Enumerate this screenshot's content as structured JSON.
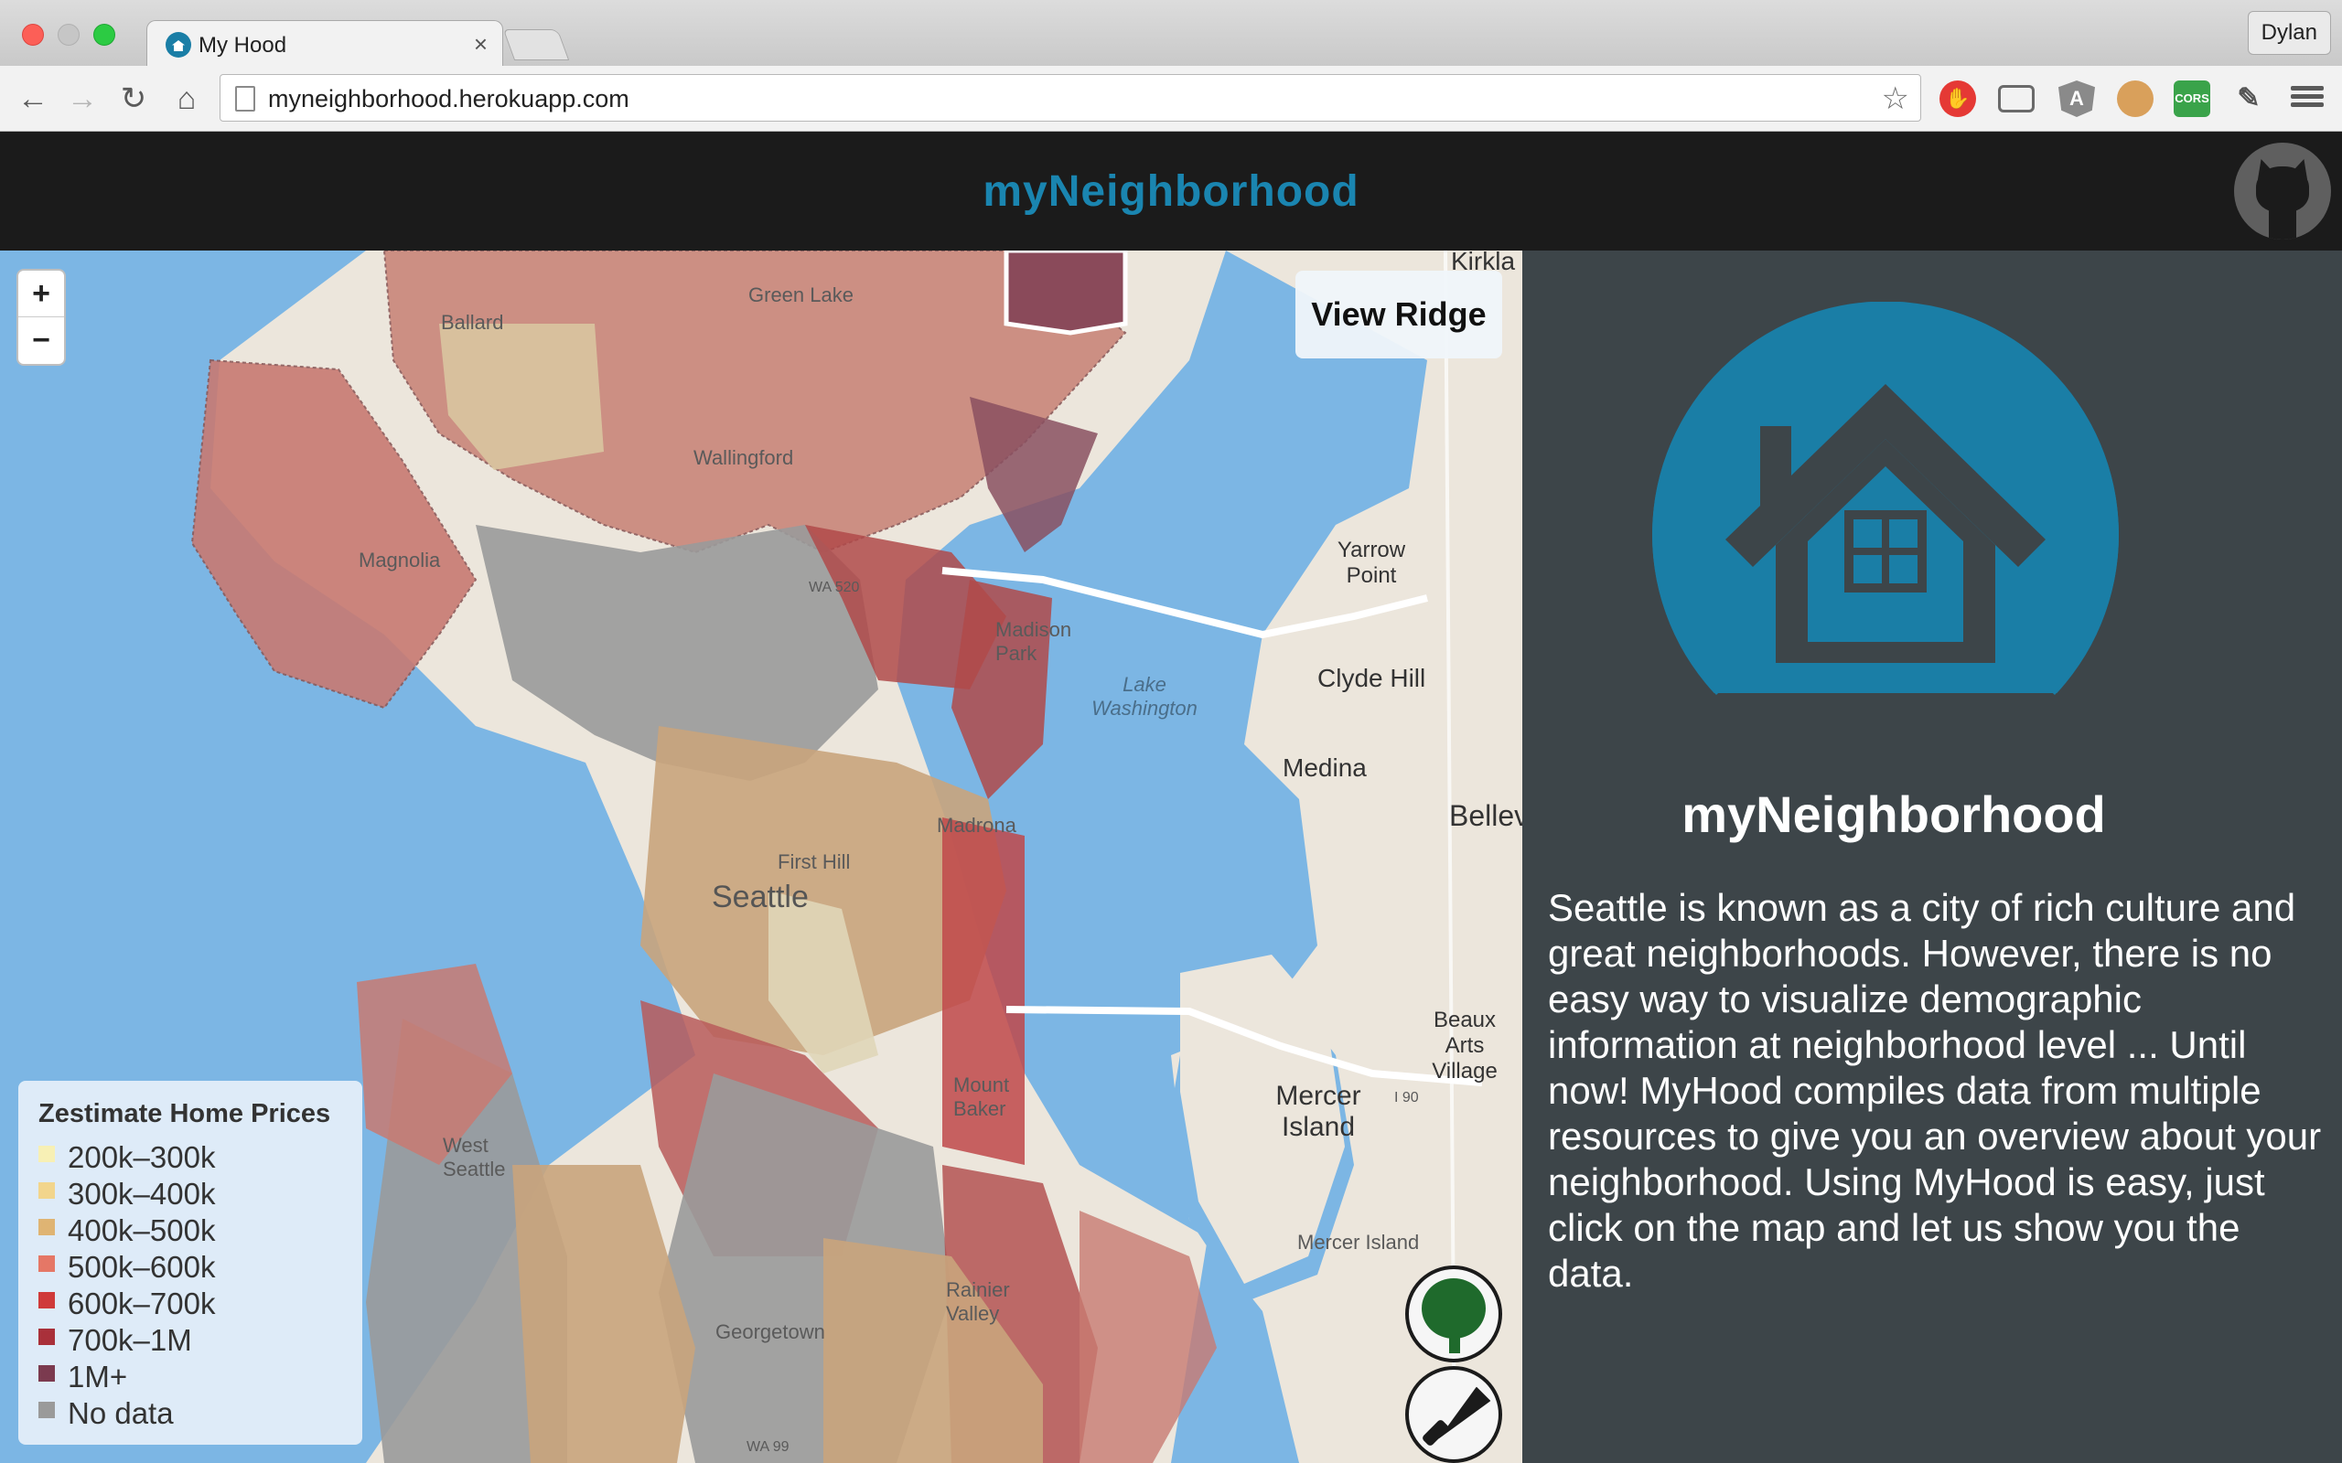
{
  "browser": {
    "tab_title": "My Hood",
    "tab_close": "×",
    "profile_name": "Dylan",
    "url": "myneighborhood.herokuapp.com",
    "back": "←",
    "forward": "→",
    "reload": "↻",
    "home": "⌂",
    "star": "☆",
    "extensions": {
      "cors_label": "CORS",
      "angular_label": "A"
    }
  },
  "site": {
    "brand": "myNeighborhood"
  },
  "map": {
    "zoom_in": "+",
    "zoom_out": "−",
    "hover_neighborhood": "View Ridge",
    "labels": {
      "green_lake": "Green Lake",
      "ballard": "Ballard",
      "wallingford": "Wallingford",
      "magnolia": "Magnolia",
      "madison_park": "Madison Park",
      "lake_washington": "Lake Washington",
      "yarrow_point": "Yarrow Point",
      "clyde_hill": "Clyde Hill",
      "medina": "Medina",
      "bellevue": "Bellev",
      "ballard_area": "Ballard",
      "first_hill": "First Hill",
      "seattle": "Seattle",
      "madrona": "Madrona",
      "mercer_island": "Mercer Island",
      "mercer_island_small": "Mercer Island",
      "beaux_arts": "Beaux Arts Village",
      "mount_baker": "Mount Baker",
      "west_seattle": "West Seattle",
      "rainier_valley": "Rainier Valley",
      "georgetown": "Georgetown",
      "kirkland": "Kirkla",
      "wa520": "WA 520",
      "i90": "I 90",
      "wa99": "WA 99"
    },
    "legend": {
      "title": "Zestimate Home Prices",
      "items": [
        {
          "label": "200k–300k",
          "color": "#f7f0b5"
        },
        {
          "label": "300k–400k",
          "color": "#f2d58c"
        },
        {
          "label": "400k–500k",
          "color": "#dfb473"
        },
        {
          "label": "500k–600k",
          "color": "#e57766"
        },
        {
          "label": "600k–700k",
          "color": "#cf3a3a"
        },
        {
          "label": "700k–1M",
          "color": "#a9303a"
        },
        {
          "label": "1M+",
          "color": "#7b3a4f"
        },
        {
          "label": "No data",
          "color": "#9a9a9a"
        }
      ]
    }
  },
  "info": {
    "title": "myNeighborhood",
    "description": "Seattle is known as a city of rich culture and great neighborhoods. However, there is no easy way to visualize demographic information at neighborhood level ... Until now! MyHood compiles data from multiple resources to give you an overview about your neighborhood. Using MyHood is easy, just click on the map and let us show you the data."
  },
  "colors": {
    "brand_blue": "#1a85b0",
    "header_bg": "#1b1b1b",
    "panel_bg": "#3d4549",
    "water": "#7cb6e4",
    "land": "#ece6dc"
  }
}
